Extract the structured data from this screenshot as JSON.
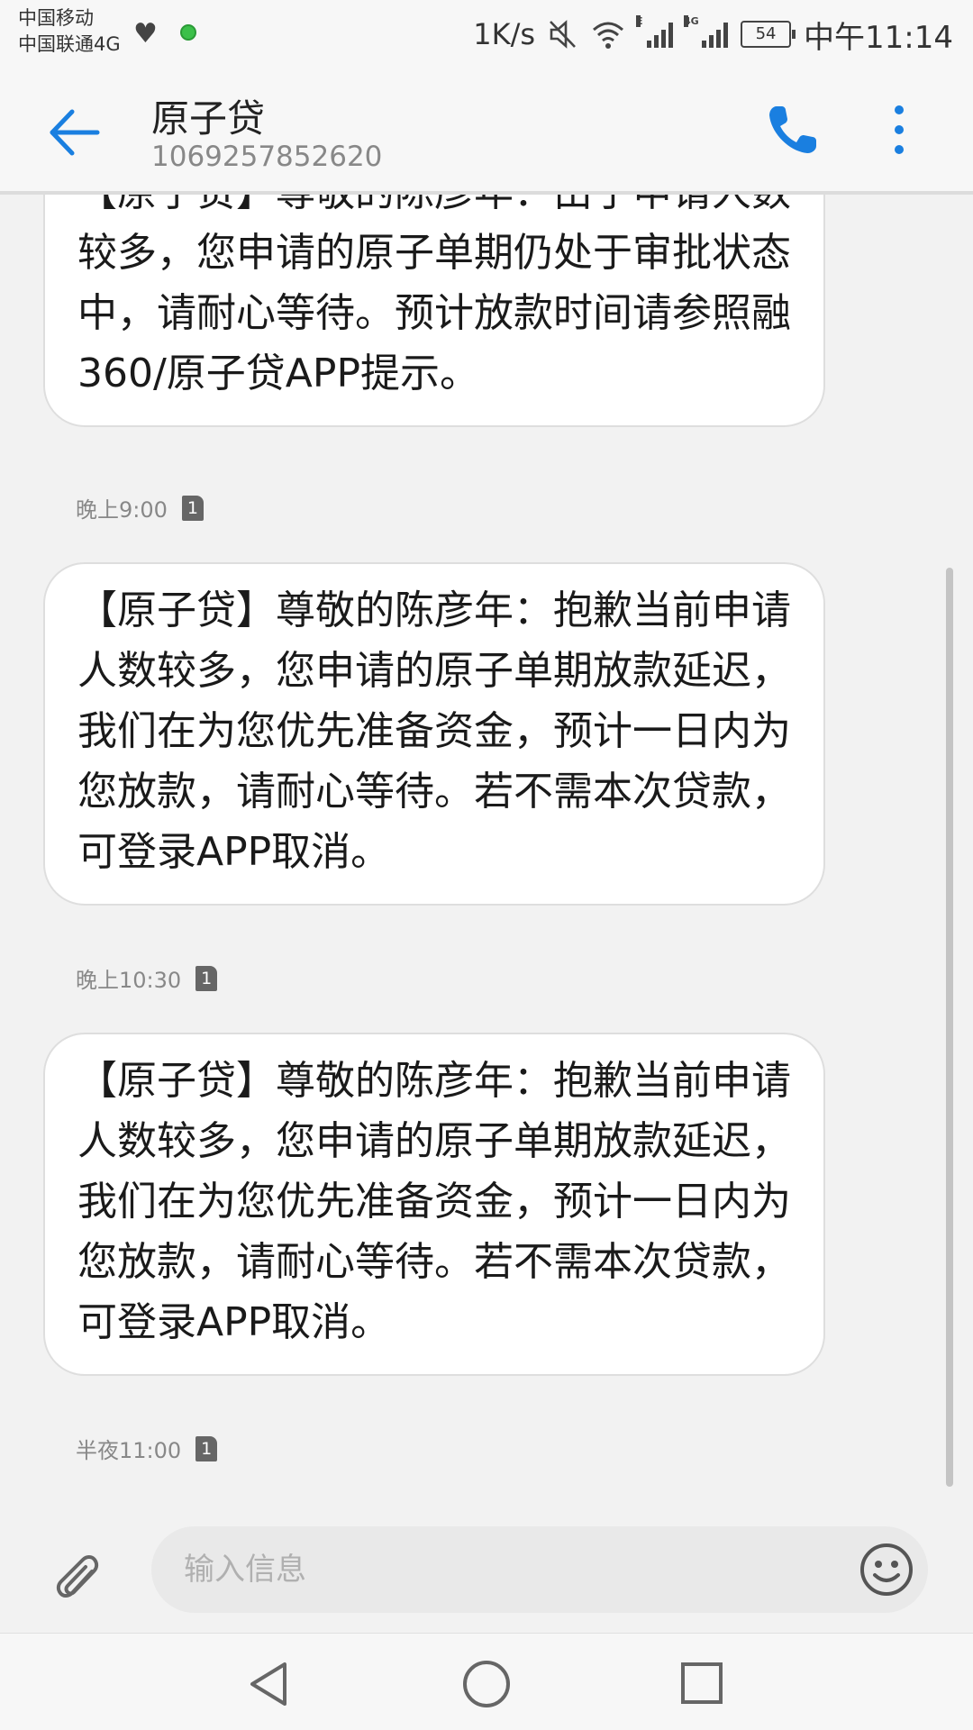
{
  "status_bar": {
    "carrier_1": "中国移动",
    "carrier_2": "中国联通4G",
    "net_speed": "1K/s",
    "signal_1_label": "E",
    "signal_2_label": "4G",
    "battery": "54",
    "time": "中午11:14",
    "icons": [
      "heart-rate-icon",
      "notification-dot-icon",
      "mute-icon",
      "wifi-icon",
      "signal-icon",
      "battery-icon"
    ]
  },
  "header": {
    "title": "原子贷",
    "subtitle": "1069257852620",
    "icons": [
      "back-arrow-icon",
      "phone-icon",
      "more-vert-icon"
    ],
    "accent_color": "#1a7fe0"
  },
  "messages": [
    {
      "text": "【原子贷】尊敬的陈彦年：由于申请人数较多，您申请的原子单期仍处于审批状态中，请耐心等待。预计放款时间请参照融360/原子贷APP提示。",
      "time": "晚上9:00",
      "sim": "1"
    },
    {
      "text": "【原子贷】尊敬的陈彦年：抱歉当前申请人数较多，您申请的原子单期放款延迟，我们在为您优先准备资金，预计一日内为您放款，请耐心等待。若不需本次贷款，可登录APP取消。",
      "time": "晚上10:30",
      "sim": "1"
    },
    {
      "text": "【原子贷】尊敬的陈彦年：抱歉当前申请人数较多，您申请的原子单期放款延迟，我们在为您优先准备资金，预计一日内为您放款，请耐心等待。若不需本次贷款，可登录APP取消。",
      "time": "半夜11:00",
      "sim": "1"
    }
  ],
  "composer": {
    "placeholder": "输入信息",
    "icons": [
      "paperclip-icon",
      "emoji-icon"
    ]
  },
  "nav_bar": {
    "icons": [
      "nav-back-icon",
      "nav-home-icon",
      "nav-recents-icon"
    ]
  }
}
